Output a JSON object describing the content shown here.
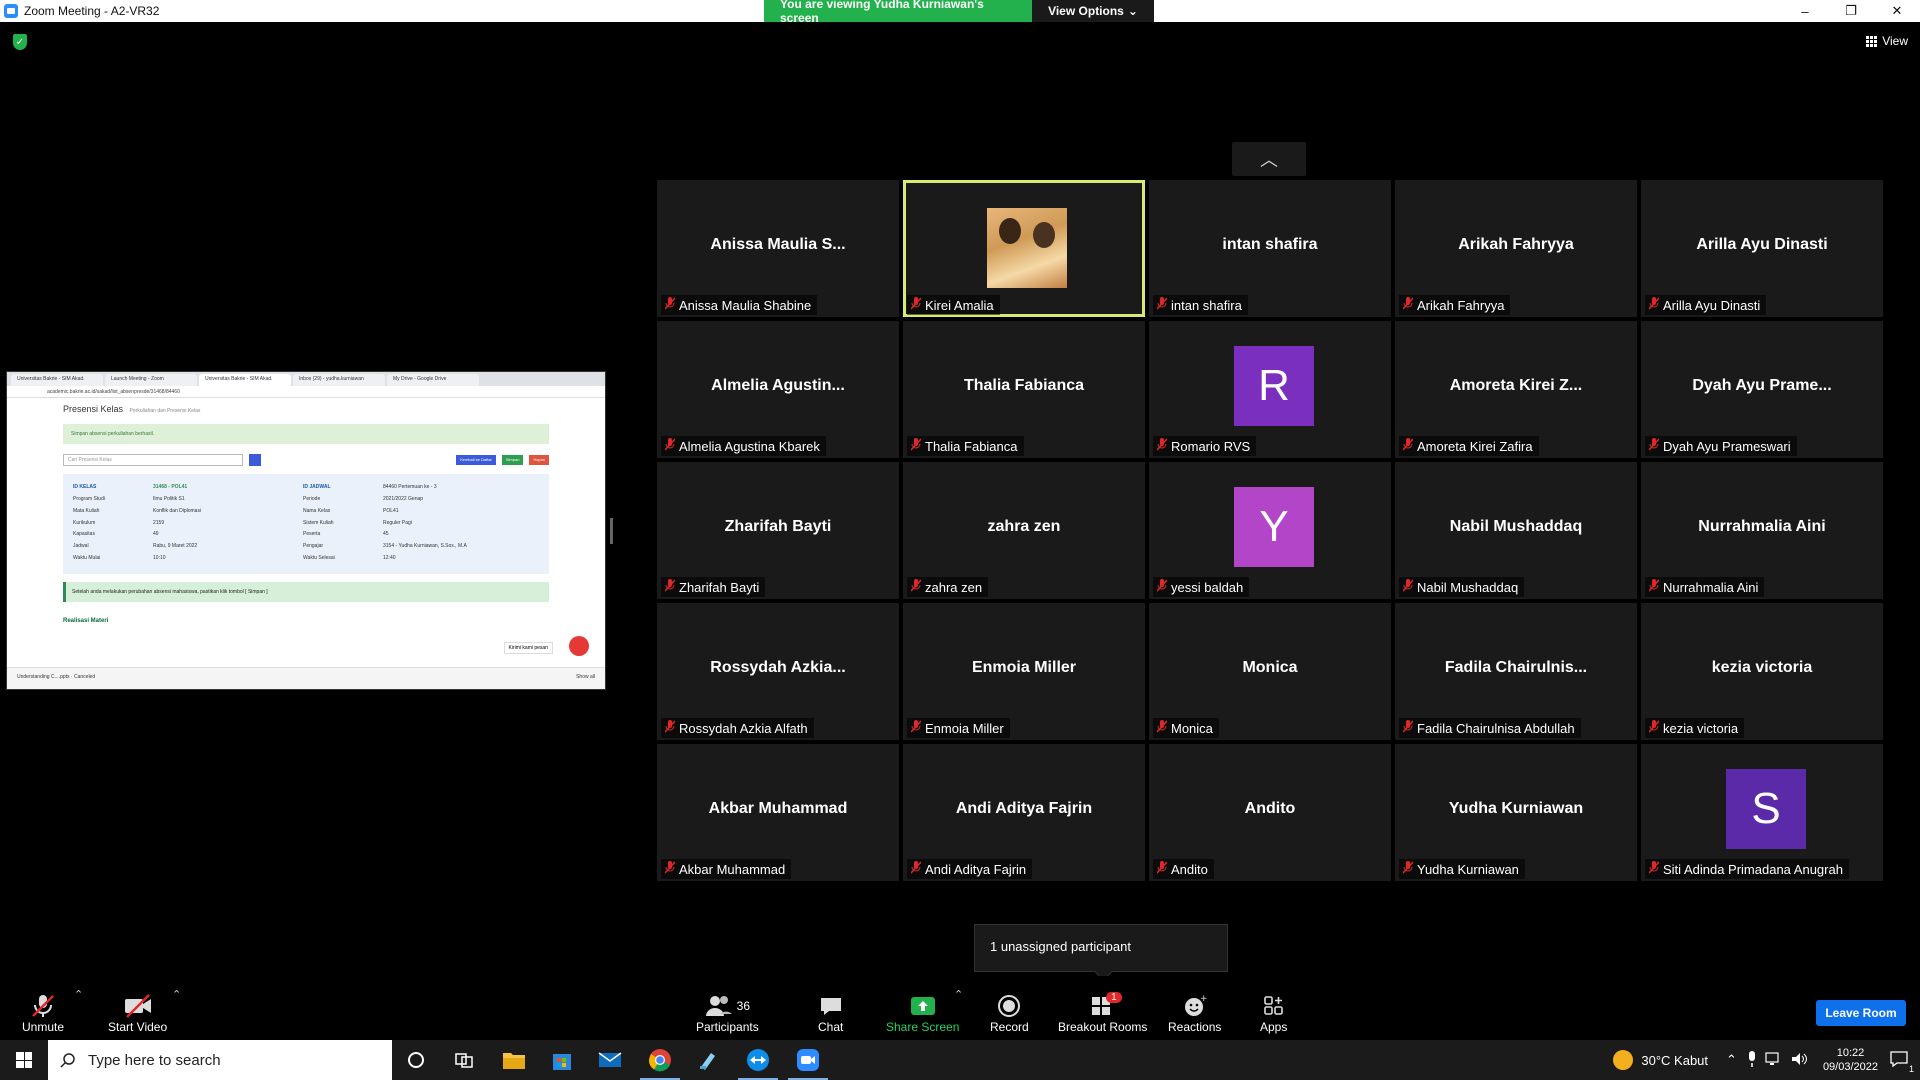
{
  "window": {
    "title": "Zoom Meeting - A2-VR32",
    "minimize": "–",
    "maximize": "❐",
    "close": "✕"
  },
  "share_banner": {
    "viewing_text": "You are viewing Yudha Kurniawan's screen",
    "view_options": "View Options",
    "view_options_caret": "⌄"
  },
  "top_right": {
    "view_label": "View"
  },
  "collapse": {
    "icon": "chevron-up-icon",
    "glyph": "︿"
  },
  "shared_screen": {
    "tabs": [
      "Universitas Bakrie - SIM Akad.",
      "Launch Meeting - Zoom",
      "Universitas Bakrie - SIM Akad.",
      "Inbox (29) - yudha.kurniawan",
      "My Drive - Google Drive"
    ],
    "url": "academic.bakrie.ac.id/sakad/list_absenpresde/31468/84460",
    "page_title": "Presensi Kelas",
    "page_subtitle": "Perkuliahan dan Presensi Kelas",
    "success_msg": "Simpan absensi perkuliahan berhasil.",
    "search_placeholder": "Cari Presensi Kelas",
    "btn_back": "Kembali ke Daftar",
    "btn_save": "Simpan",
    "btn_delete": "Hapus",
    "info": [
      [
        "ID KELAS",
        "31468 - POL41",
        "ID JADWAL",
        "84460 Pertemuan ke - 3"
      ],
      [
        "Program Studi",
        "Ilmu Politik S1",
        "Periode",
        "2021/2022 Genap"
      ],
      [
        "Mata Kuliah",
        "Konflik dan Diplomasi",
        "Nama Kelas",
        "POL41"
      ],
      [
        "Kurikulum",
        "2159",
        "Sistem Kuliah",
        "Reguler Pagi"
      ],
      [
        "Kapasitas",
        "49",
        "Peserta",
        "45"
      ],
      [
        "Jadwal",
        "Rabu, 9 Maret 2022",
        "Pengajar",
        "3154 - Yudha Kurniawan, S.Sos., M.A"
      ],
      [
        "Waktu Mulai",
        "10:10",
        "Waktu Selesai",
        "12:40"
      ]
    ],
    "note": "Setelah anda melakukan perubahan absensi mahasiswa, pastikan klik tombol [ Simpan ]",
    "chat_tip": "Kirimi kami pesan",
    "realisasi": "Realisasi Materi",
    "download_file": "Understanding C....pptx",
    "download_status": "Canceled",
    "show_all": "Show all"
  },
  "participants_grid": [
    {
      "big": "Anissa  Maulia  S...",
      "name": "Anissa Maulia Shabine"
    },
    {
      "big": "",
      "name": "Kirei Amalia",
      "photo": true,
      "active": true
    },
    {
      "big": "intan shafira",
      "name": "intan shafira"
    },
    {
      "big": "Arikah Fahryya",
      "name": "Arikah Fahryya"
    },
    {
      "big": "Arilla Ayu Dinasti",
      "name": "Arilla Ayu Dinasti"
    },
    {
      "big": "Almelia  Agustin...",
      "name": "Almelia Agustina Kbarek"
    },
    {
      "big": "Thalia Fabianca",
      "name": "Thalia Fabianca"
    },
    {
      "big": "",
      "name": "Romario RVS",
      "avatar": "R",
      "avatar_color": "#7b2fbf"
    },
    {
      "big": "Amoreta  Kirei  Z...",
      "name": "Amoreta Kirei Zafira"
    },
    {
      "big": "Dyah Ayu Prame...",
      "name": "Dyah Ayu Prameswari"
    },
    {
      "big": "Zharifah Bayti",
      "name": "Zharifah Bayti"
    },
    {
      "big": "zahra zen",
      "name": "zahra zen"
    },
    {
      "big": "",
      "name": "yessi baldah",
      "avatar": "Y",
      "avatar_color": "#b245c8"
    },
    {
      "big": "Nabil Mushaddaq",
      "name": "Nabil Mushaddaq"
    },
    {
      "big": "Nurrahmalia Aini",
      "name": "Nurrahmalia Aini"
    },
    {
      "big": "Rossydah  Azkia...",
      "name": "Rossydah Azkia Alfath"
    },
    {
      "big": "Enmoia Miller",
      "name": "Enmoia Miller"
    },
    {
      "big": "Monica",
      "name": "Monica"
    },
    {
      "big": "Fadila  Chairulnis...",
      "name": "Fadila Chairulnisa Abdullah"
    },
    {
      "big": "kezia victoria",
      "name": "kezia victoria"
    },
    {
      "big": "Akbar Muhammad",
      "name": "Akbar Muhammad"
    },
    {
      "big": "Andi Aditya Fajrin",
      "name": "Andi Aditya Fajrin"
    },
    {
      "big": "Andito",
      "name": "Andito"
    },
    {
      "big": "Yudha Kurniawan",
      "name": "Yudha Kurniawan"
    },
    {
      "big": "",
      "name": "Siti Adinda Primadana Anugrah",
      "avatar": "S",
      "avatar_color": "#5b2aa8"
    }
  ],
  "unassigned": "1 unassigned participant",
  "toolbar": {
    "unmute": "Unmute",
    "start_video": "Start Video",
    "participants": "Participants",
    "participants_count": "36",
    "chat": "Chat",
    "share_screen": "Share Screen",
    "record": "Record",
    "breakout_rooms": "Breakout Rooms",
    "breakout_badge": "1",
    "reactions": "Reactions",
    "apps": "Apps",
    "leave": "Leave Room"
  },
  "taskbar": {
    "search_placeholder": "Type here to search",
    "weather": "30°C  Kabut",
    "time": "10:22",
    "date": "09/03/2022",
    "notification_count": "1"
  },
  "colors": {
    "share_green": "#23b14d",
    "active_speaker": "#d6eb71",
    "leave_blue": "#0e71eb",
    "mute_red": "#e02828"
  }
}
